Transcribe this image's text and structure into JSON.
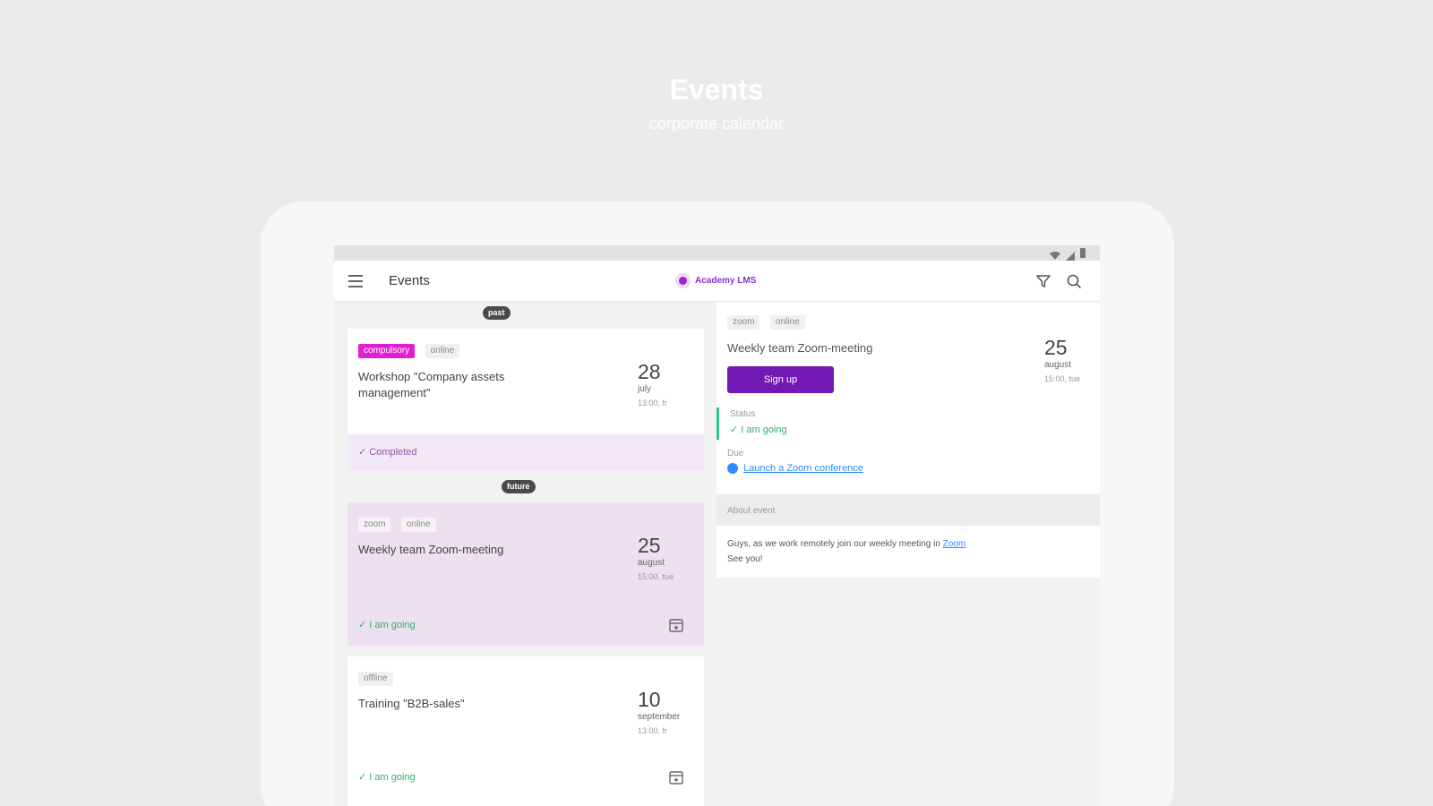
{
  "promo": {
    "title": "Events",
    "subtitle": "corporate calendar"
  },
  "appbar": {
    "title": "Events",
    "brand": "Academy LMS"
  },
  "feed": {
    "past_label": "past",
    "future_label": "future",
    "past_events": [
      {
        "tags": [
          "compulsory",
          "online"
        ],
        "title": "Workshop \"Company assets management\"",
        "day": "28",
        "month": "july",
        "time": "13:00, fr",
        "status": "✓  Completed"
      }
    ],
    "future_events": [
      {
        "tags": [
          "zoom",
          "online"
        ],
        "title": "Weekly team Zoom-meeting",
        "day": "25",
        "month": "august",
        "time": "15:00, tue",
        "status": "✓  I am going"
      },
      {
        "tags": [
          "offline"
        ],
        "title": "Training \"B2B-sales\"",
        "day": "10",
        "month": "september",
        "time": "13:00, fr",
        "status": "✓  I am going"
      }
    ]
  },
  "detail": {
    "tags": [
      "zoom",
      "online"
    ],
    "title": "Weekly team Zoom-meeting",
    "signup_label": "Sign up",
    "day": "25",
    "month": "august",
    "time": "15:00, tue",
    "status_label": "Status",
    "status_value": "✓  I am going",
    "where_label": "Due",
    "where_link": "Launch a Zoom conference",
    "about_label": "About event",
    "about_text": "Guys, as we work remotely join our weekly meeting in",
    "about_link": "Zoom",
    "about_text_2": "See you!"
  },
  "colors": {
    "accent": "#7219b4",
    "compulsory_tag": "#e21fd0",
    "going": "#30b070",
    "link": "#2d8cff",
    "highlight_card": "#ede0f0"
  },
  "icons": [
    "wifi-icon",
    "signal-icon",
    "battery-icon",
    "menu-icon",
    "filter-icon",
    "search-icon",
    "calendar-add-icon",
    "zoom-icon"
  ]
}
